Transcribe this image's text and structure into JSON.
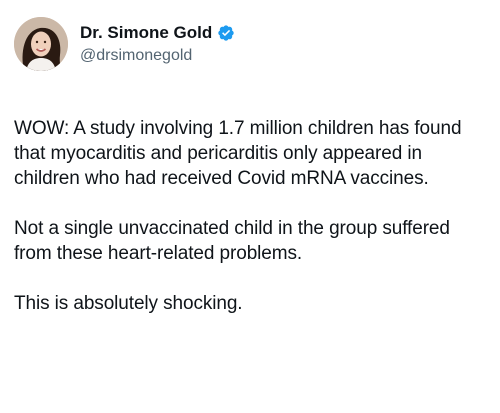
{
  "author": {
    "display_name": "Dr. Simone Gold",
    "handle": "@drsimonegold",
    "verified": true,
    "verified_color": "#1d9bf0",
    "avatar_icon": "profile-photo"
  },
  "tweet": {
    "paragraphs": [
      "WOW: A study involving 1.7 million children has found that myocarditis and pericarditis only appeared in children who had received Covid mRNA vaccines.",
      "Not a single unvaccinated child in the group suffered from these heart-related problems.",
      "This is absolutely shocking."
    ]
  }
}
